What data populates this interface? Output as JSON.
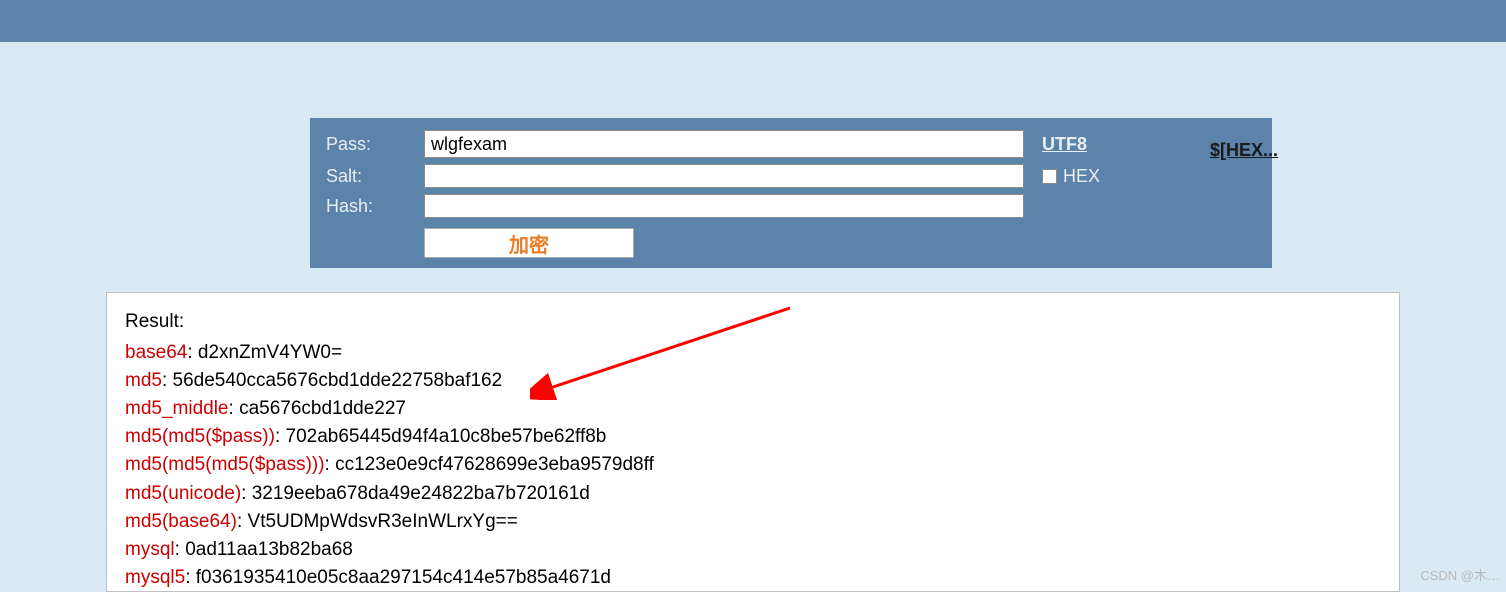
{
  "form": {
    "pass_label": "Pass:",
    "pass_value": "wlgfexam",
    "salt_label": "Salt:",
    "salt_value": "",
    "hash_label": "Hash:",
    "hash_value": "",
    "utf8_link": "UTF8",
    "hex_checkbox_label": "HEX",
    "encrypt_btn": "加密",
    "hex_dollar_link": "$[HEX..."
  },
  "result": {
    "title": "Result:",
    "lines": [
      {
        "key": "base64",
        "value": "d2xnZmV4YW0="
      },
      {
        "key": "md5",
        "value": "56de540cca5676cbd1dde22758baf162"
      },
      {
        "key": "md5_middle",
        "value": "ca5676cbd1dde227"
      },
      {
        "key": "md5(md5($pass))",
        "value": "702ab65445d94f4a10c8be57be62ff8b"
      },
      {
        "key": "md5(md5(md5($pass)))",
        "value": "cc123e0e9cf47628699e3eba9579d8ff"
      },
      {
        "key": "md5(unicode)",
        "value": "3219eeba678da49e24822ba7b720161d"
      },
      {
        "key": "md5(base64)",
        "value": "Vt5UDMpWdsvR3eInWLrxYg=="
      },
      {
        "key": "mysql",
        "value": "0ad11aa13b82ba68"
      },
      {
        "key": "mysql5",
        "value": "f0361935410e05c8aa297154c414e57b85a4671d"
      }
    ]
  },
  "watermark": "CSDN @木…"
}
